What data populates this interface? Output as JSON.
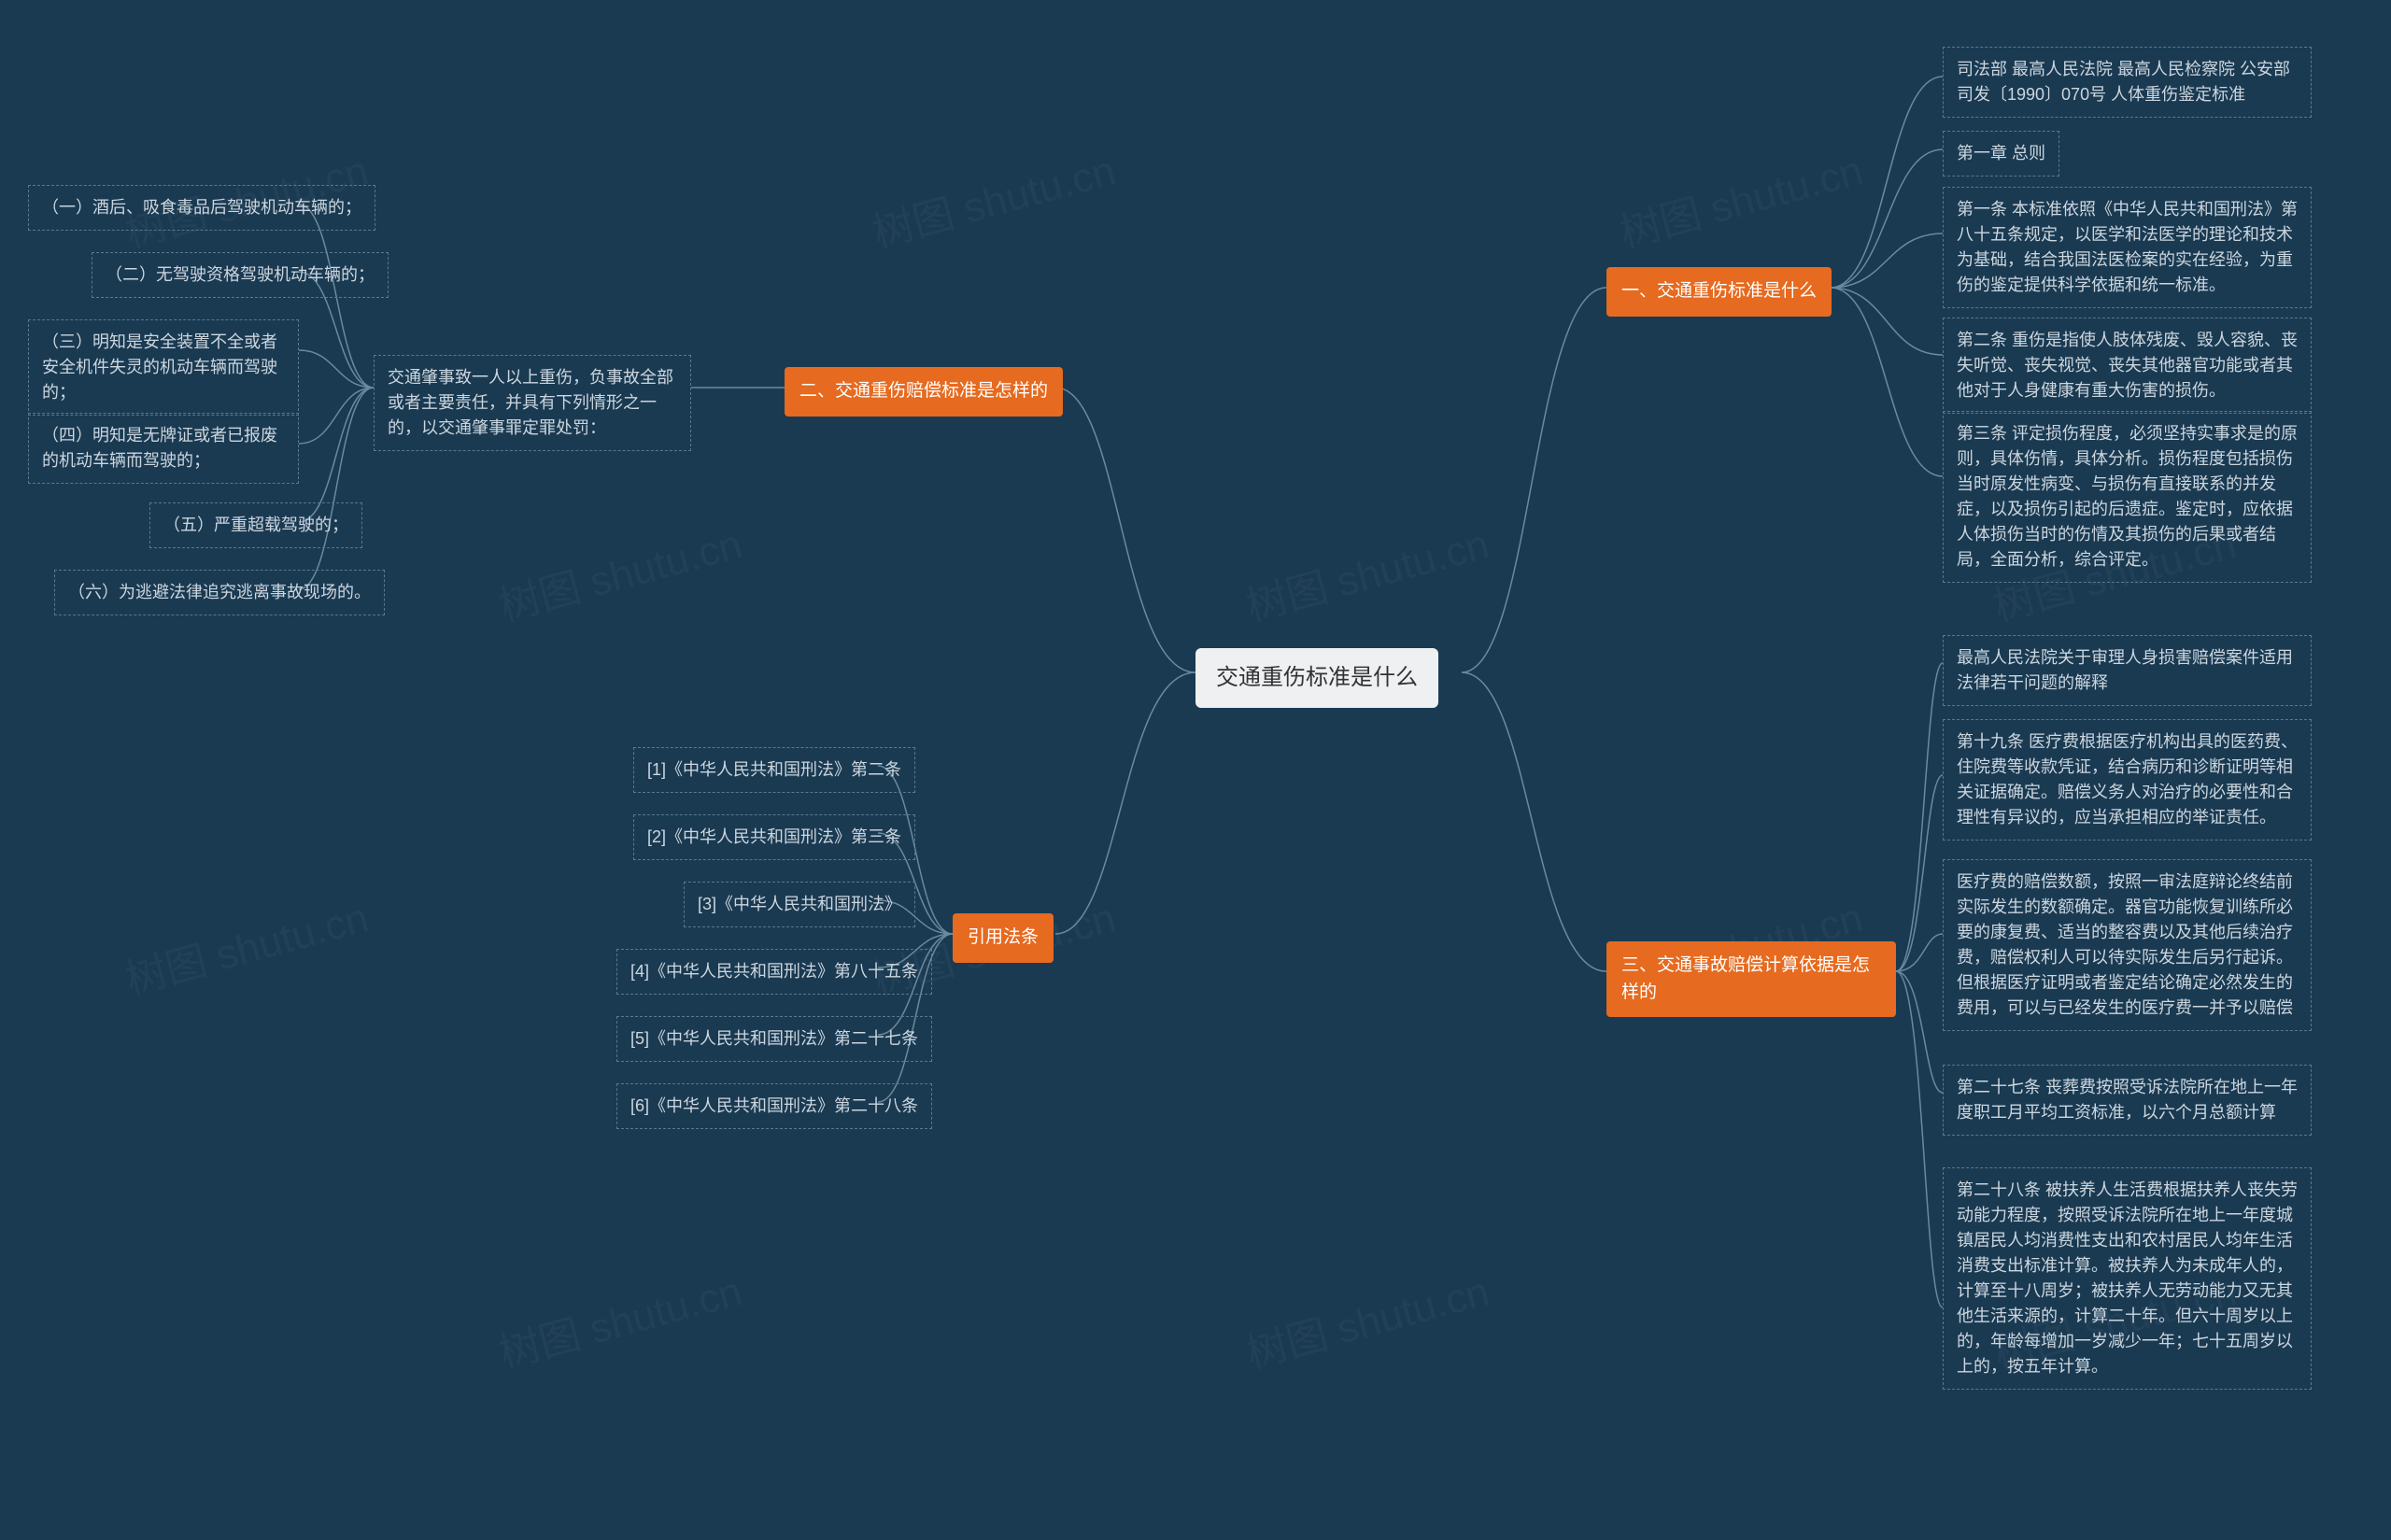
{
  "root": "交通重伤标准是什么",
  "branches": {
    "b1": {
      "title": "一、交通重伤标准是什么"
    },
    "b2": {
      "title": "二、交通重伤赔偿标准是怎样的"
    },
    "b3": {
      "title": "三、交通事故赔偿计算依据是怎样的"
    },
    "b4": {
      "title": "引用法条"
    }
  },
  "b1_children": [
    "司法部 最高人民法院 最高人民检察院 公安部 司发〔1990〕070号 人体重伤鉴定标准",
    "第一章 总则",
    "第一条 本标准依照《中华人民共和国刑法》第八十五条规定，以医学和法医学的理论和技术为基础，结合我国法医检案的实在经验，为重伤的鉴定提供科学依据和统一标准。",
    "第二条 重伤是指使人肢体残废、毁人容貌、丧失听觉、丧失视觉、丧失其他器官功能或者其他对于人身健康有重大伤害的损伤。",
    "第三条 评定损伤程度，必须坚持实事求是的原则，具体伤情，具体分析。损伤程度包括损伤当时原发性病变、与损伤有直接联系的并发症，以及损伤引起的后遗症。鉴定时，应依据人体损伤当时的伤情及其损伤的后果或者结局，全面分析，综合评定。"
  ],
  "b2_intermediate": "交通肇事致一人以上重伤，负事故全部或者主要责任，并具有下列情形之一的，以交通肇事罪定罪处罚：",
  "b2_children": [
    "（一）酒后、吸食毒品后驾驶机动车辆的；",
    "（二）无驾驶资格驾驶机动车辆的；",
    "（三）明知是安全装置不全或者安全机件失灵的机动车辆而驾驶的；",
    "（四）明知是无牌证或者已报废的机动车辆而驾驶的；",
    "（五）严重超载驾驶的；",
    "（六）为逃避法律追究逃离事故现场的。"
  ],
  "b3_children": [
    "最高人民法院关于审理人身损害赔偿案件适用法律若干问题的解释",
    "第十九条 医疗费根据医疗机构出具的医药费、住院费等收款凭证，结合病历和诊断证明等相关证据确定。赔偿义务人对治疗的必要性和合理性有异议的，应当承担相应的举证责任。",
    "医疗费的赔偿数额，按照一审法庭辩论终结前实际发生的数额确定。器官功能恢复训练所必要的康复费、适当的整容费以及其他后续治疗费，赔偿权利人可以待实际发生后另行起诉。但根据医疗证明或者鉴定结论确定必然发生的费用，可以与已经发生的医疗费一并予以赔偿",
    "第二十七条 丧葬费按照受诉法院所在地上一年度职工月平均工资标准，以六个月总额计算",
    "第二十八条 被扶养人生活费根据扶养人丧失劳动能力程度，按照受诉法院所在地上一年度城镇居民人均消费性支出和农村居民人均年生活消费支出标准计算。被扶养人为未成年人的，计算至十八周岁；被扶养人无劳动能力又无其他生活来源的，计算二十年。但六十周岁以上的，年龄每增加一岁减少一年；七十五周岁以上的，按五年计算。"
  ],
  "b4_children": [
    "[1]《中华人民共和国刑法》第二条",
    "[2]《中华人民共和国刑法》第三条",
    "[3]《中华人民共和国刑法》",
    "[4]《中华人民共和国刑法》第八十五条",
    "[5]《中华人民共和国刑法》第二十七条",
    "[6]《中华人民共和国刑法》第二十八条"
  ],
  "watermark": "树图 shutu.cn"
}
